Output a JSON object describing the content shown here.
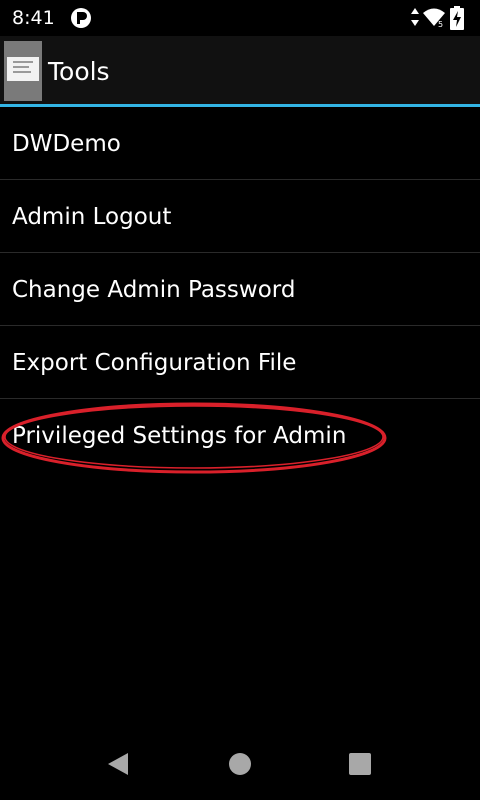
{
  "status_bar": {
    "time": "8:41",
    "battery_icon": "battery-charging-icon",
    "wifi_icon": "wifi-icon",
    "data_icon": "data-arrows-icon"
  },
  "header": {
    "title": "Tools",
    "accent_color": "#33b5e5"
  },
  "menu": {
    "items": [
      {
        "label": "DWDemo"
      },
      {
        "label": "Admin Logout"
      },
      {
        "label": "Change Admin Password"
      },
      {
        "label": "Export Configuration File"
      },
      {
        "label": "Privileged Settings for Admin",
        "highlighted": true
      }
    ],
    "highlight_color": "#d9202a"
  },
  "nav_bar": {
    "back_icon": "back-triangle-icon",
    "home_icon": "home-circle-icon",
    "recents_icon": "recents-square-icon"
  }
}
